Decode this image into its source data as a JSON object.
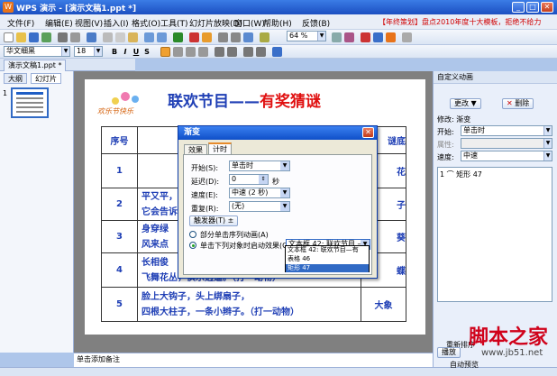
{
  "window": {
    "title": "WPS 演示 - [演示文稿1.ppt *]",
    "app_icon": "W"
  },
  "menu": {
    "items": [
      "文件(F)",
      "编辑(E)",
      "视图(V)",
      "插入(I)",
      "格式(O)",
      "工具(T)",
      "幻灯片放映(D)",
      "窗口(W)",
      "帮助(H)",
      "反馈(B)"
    ],
    "promo": "【年终策划】盘点2010年度十大模板，拒绝不给力"
  },
  "toolbar": {
    "zoom": "64 %",
    "font_name": "华文细黑",
    "font_size": "18",
    "bold": "B",
    "italic": "I",
    "underline": "U",
    "shadow": "S"
  },
  "doc_tabs": {
    "file_tab": "演示文稿1.ppt *"
  },
  "left_panel": {
    "tabs": [
      "大纲",
      "幻灯片"
    ],
    "slide_number": "1"
  },
  "slide": {
    "decor_text": "欢乐节快乐",
    "title_left": "联欢节目",
    "title_dash": "——",
    "title_right": "有奖猜谜",
    "headers": [
      "序号",
      "",
      "谜底"
    ],
    "rows": [
      {
        "num": "1",
        "line1": "",
        "line2": "",
        "answer": "花"
      },
      {
        "num": "2",
        "line1": "平又平，",
        "line2": "它会告诉",
        "answer": "子"
      },
      {
        "num": "3",
        "line1": "身穿绿",
        "line2": "风来点",
        "answer": "葵"
      },
      {
        "num": "4",
        "line1": "长相俊",
        "line2": "飞舞花丛，俱乐逍遥。（打一动物）",
        "answer": "蝶"
      },
      {
        "num": "5",
        "line1": "脸上大钩子，头上绑扇子，",
        "line2": "四根大柱子，一条小辫子。（打一动物）",
        "answer": "大象"
      }
    ]
  },
  "notes": {
    "placeholder": "单击添加备注"
  },
  "right_panel": {
    "header": "自定义动画",
    "change_btn": "更改",
    "delete_btn": "删除",
    "modify_label": "修改: 渐变",
    "start_label": "开始:",
    "start_value": "单击时",
    "property_label": "属性:",
    "speed_label": "速度:",
    "speed_value": "中速",
    "list_item": "1 ⌒ 矩形 47",
    "reorder_label": "重新排序",
    "play_btn": "播放",
    "autopreview": "自动预览"
  },
  "dialog": {
    "title": "渐变",
    "tabs": [
      "效果",
      "计时"
    ],
    "start_label": "开始(S):",
    "start_value": "单击时",
    "delay_label": "延迟(D):",
    "delay_value": "0",
    "delay_unit": "秒",
    "speed_label": "速度(E):",
    "speed_value": "中速 (2 秒)",
    "repeat_label": "重复(R):",
    "repeat_value": "(无)",
    "trigger_btn": "触发器(T) ±",
    "radio1": "部分单击序列动画(A)",
    "radio2": "单击下列对象时启动效果(C):",
    "object_value": "文本框 42: 联欢节目 —",
    "options": [
      "文本框 42: 联欢节目—有",
      "表格 46",
      "矩形 47"
    ]
  },
  "watermark": {
    "big": "脚本之家",
    "small": "www.jb51.net"
  },
  "colors": {
    "title_blue": "#1f3fb5",
    "title_red": "#e01010",
    "selection": "#316ac5"
  }
}
